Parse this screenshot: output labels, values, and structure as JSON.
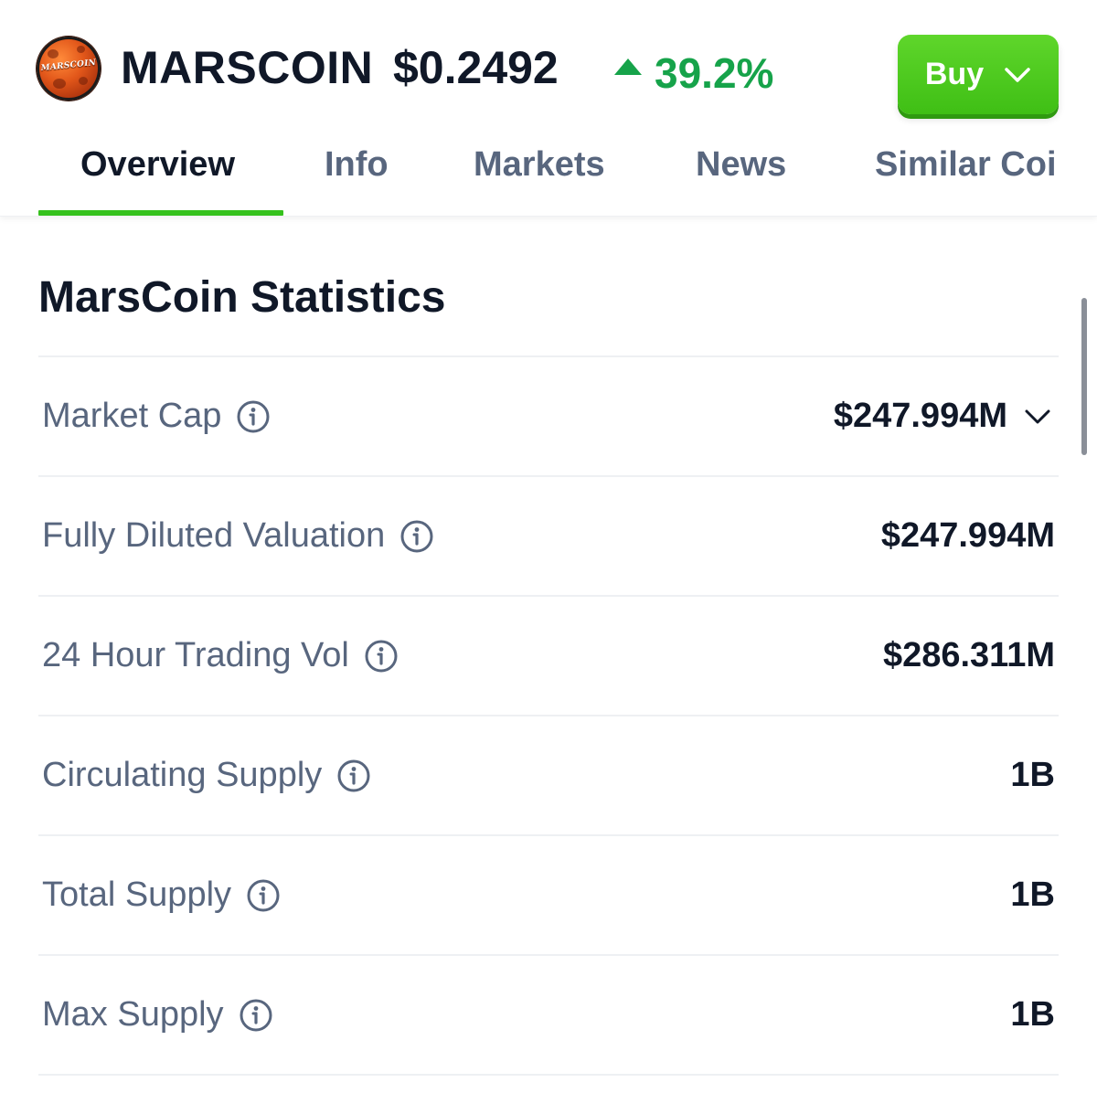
{
  "header": {
    "logo_text": "MARSCOIN",
    "coin_name": "MARSCOIN",
    "price": "$0.2492",
    "change": "39.2%",
    "change_direction": "up",
    "change_color": "#16a34a",
    "buy_label": "Buy"
  },
  "tabs": [
    {
      "label": "Overview",
      "active": true
    },
    {
      "label": "Info",
      "active": false
    },
    {
      "label": "Markets",
      "active": false
    },
    {
      "label": "News",
      "active": false
    },
    {
      "label": "Similar Coi",
      "active": false
    }
  ],
  "accent_color": "#35c11c",
  "statistics": {
    "title": "MarsCoin Statistics",
    "rows": [
      {
        "label": "Market Cap",
        "value": "$247.994M",
        "expandable": true
      },
      {
        "label": "Fully Diluted Valuation",
        "value": "$247.994M",
        "expandable": false
      },
      {
        "label": "24 Hour Trading Vol",
        "value": "$286.311M",
        "expandable": false
      },
      {
        "label": "Circulating Supply",
        "value": "1B",
        "expandable": false
      },
      {
        "label": "Total Supply",
        "value": "1B",
        "expandable": false
      },
      {
        "label": "Max Supply",
        "value": "1B",
        "expandable": false
      }
    ]
  }
}
